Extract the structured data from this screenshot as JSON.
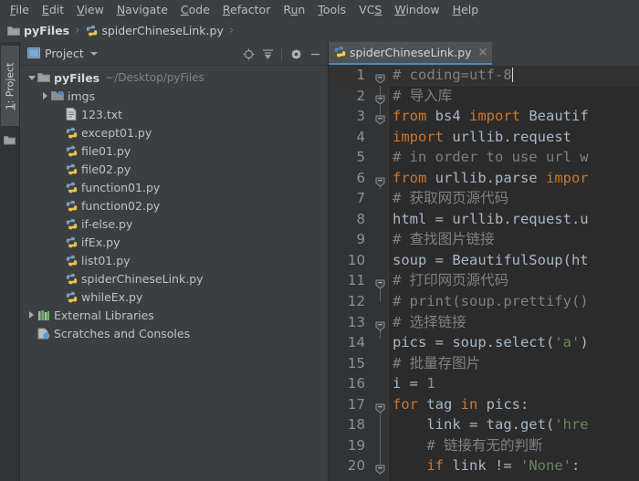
{
  "window": {
    "strip_color": "#8ab4d8"
  },
  "menubar": {
    "items": [
      {
        "label": "File",
        "mnemonic": "F"
      },
      {
        "label": "Edit",
        "mnemonic": "E"
      },
      {
        "label": "View",
        "mnemonic": "V"
      },
      {
        "label": "Navigate",
        "mnemonic": "N"
      },
      {
        "label": "Code",
        "mnemonic": "C"
      },
      {
        "label": "Refactor",
        "mnemonic": "R"
      },
      {
        "label": "Run",
        "mnemonic": "u"
      },
      {
        "label": "Tools",
        "mnemonic": "T"
      },
      {
        "label": "VCS",
        "mnemonic": "S"
      },
      {
        "label": "Window",
        "mnemonic": "W"
      },
      {
        "label": "Help",
        "mnemonic": "H"
      }
    ]
  },
  "breadcrumb": {
    "items": [
      {
        "label": "pyFiles",
        "icon": "folder-icon",
        "bold": true
      },
      {
        "label": "spiderChineseLink.py",
        "icon": "python-file-icon",
        "bold": false
      }
    ],
    "separator": "›"
  },
  "toolstrip": {
    "vertical_tab": {
      "label": "1: Project",
      "mnemonic": "1"
    },
    "bottom_icon": "folder-icon"
  },
  "project_panel": {
    "title": "Project",
    "actions": [
      {
        "name": "locate-icon",
        "tooltip": "Select Opened File"
      },
      {
        "name": "collapse-all-icon",
        "tooltip": "Collapse All"
      },
      {
        "name": "gear-icon",
        "tooltip": "Settings"
      },
      {
        "name": "minimize-icon",
        "tooltip": "Hide"
      }
    ],
    "tree": [
      {
        "label": "pyFiles",
        "sub": "~/Desktop/pyFiles",
        "indent": 0,
        "twisty": "down",
        "icon": "folder-icon",
        "bold": true
      },
      {
        "label": "imgs",
        "sub": "",
        "indent": 1,
        "twisty": "right",
        "icon": "folder-blue-icon",
        "bold": false
      },
      {
        "label": "123.txt",
        "sub": "",
        "indent": 2,
        "twisty": "none",
        "icon": "text-file-icon",
        "bold": false
      },
      {
        "label": "except01.py",
        "sub": "",
        "indent": 2,
        "twisty": "none",
        "icon": "python-file-icon",
        "bold": false
      },
      {
        "label": "file01.py",
        "sub": "",
        "indent": 2,
        "twisty": "none",
        "icon": "python-file-icon",
        "bold": false
      },
      {
        "label": "file02.py",
        "sub": "",
        "indent": 2,
        "twisty": "none",
        "icon": "python-file-icon",
        "bold": false
      },
      {
        "label": "function01.py",
        "sub": "",
        "indent": 2,
        "twisty": "none",
        "icon": "python-file-icon",
        "bold": false
      },
      {
        "label": "function02.py",
        "sub": "",
        "indent": 2,
        "twisty": "none",
        "icon": "python-file-icon",
        "bold": false
      },
      {
        "label": "if-else.py",
        "sub": "",
        "indent": 2,
        "twisty": "none",
        "icon": "python-file-icon",
        "bold": false
      },
      {
        "label": "ifEx.py",
        "sub": "",
        "indent": 2,
        "twisty": "none",
        "icon": "python-file-icon",
        "bold": false
      },
      {
        "label": "list01.py",
        "sub": "",
        "indent": 2,
        "twisty": "none",
        "icon": "python-file-icon",
        "bold": false
      },
      {
        "label": "spiderChineseLink.py",
        "sub": "",
        "indent": 2,
        "twisty": "none",
        "icon": "python-file-icon",
        "bold": false
      },
      {
        "label": "whileEx.py",
        "sub": "",
        "indent": 2,
        "twisty": "none",
        "icon": "python-file-icon",
        "bold": false
      },
      {
        "label": "External Libraries",
        "sub": "",
        "indent": 0,
        "twisty": "right",
        "icon": "library-icon",
        "bold": false
      },
      {
        "label": "Scratches and Consoles",
        "sub": "",
        "indent": 0,
        "twisty": "none",
        "icon": "scratches-icon",
        "bold": false
      }
    ]
  },
  "editor": {
    "tab": {
      "label": "spiderChineseLink.py",
      "icon": "python-file-icon",
      "close": "×",
      "active_underline": "#4a88c7"
    },
    "current_line": 1,
    "lines": [
      {
        "n": 1,
        "fold": "collapsed-start",
        "tokens": [
          {
            "t": "# coding=utf-8",
            "c": "com"
          }
        ],
        "caret_after": true
      },
      {
        "n": 2,
        "fold": "collapsed-start",
        "tokens": [
          {
            "t": "# 导入库",
            "c": "com"
          }
        ]
      },
      {
        "n": 3,
        "fold": "collapsed-start",
        "tokens": [
          {
            "t": "from",
            "c": "kw"
          },
          {
            "t": " bs4 ",
            "c": "plain"
          },
          {
            "t": "import",
            "c": "kw"
          },
          {
            "t": " Beautif",
            "c": "plain"
          }
        ]
      },
      {
        "n": 4,
        "fold": "none",
        "tokens": [
          {
            "t": "import",
            "c": "kw"
          },
          {
            "t": " urllib.request",
            "c": "plain"
          }
        ]
      },
      {
        "n": 5,
        "fold": "none",
        "tokens": [
          {
            "t": "# in order to use url w",
            "c": "com"
          }
        ]
      },
      {
        "n": 6,
        "fold": "collapsed-start",
        "tokens": [
          {
            "t": "from",
            "c": "kw"
          },
          {
            "t": " urllib.parse ",
            "c": "plain"
          },
          {
            "t": "impor",
            "c": "kw"
          }
        ]
      },
      {
        "n": 7,
        "fold": "none",
        "tokens": [
          {
            "t": "# 获取网页源代码",
            "c": "com"
          }
        ]
      },
      {
        "n": 8,
        "fold": "none",
        "tokens": [
          {
            "t": "html = urllib.request.u",
            "c": "plain"
          }
        ]
      },
      {
        "n": 9,
        "fold": "none",
        "tokens": [
          {
            "t": "# 查找图片链接",
            "c": "com"
          }
        ]
      },
      {
        "n": 10,
        "fold": "none",
        "tokens": [
          {
            "t": "soup = BeautifulSoup(ht",
            "c": "plain"
          }
        ]
      },
      {
        "n": 11,
        "fold": "collapsed-start",
        "tokens": [
          {
            "t": "# 打印网页源代码",
            "c": "com"
          }
        ]
      },
      {
        "n": 12,
        "fold": "none",
        "tokens": [
          {
            "t": "# print(soup.prettify()",
            "c": "com"
          }
        ]
      },
      {
        "n": 13,
        "fold": "collapsed-start",
        "tokens": [
          {
            "t": "# 选择链接",
            "c": "com"
          }
        ]
      },
      {
        "n": 14,
        "fold": "none",
        "tokens": [
          {
            "t": "pics = soup.select(",
            "c": "plain"
          },
          {
            "t": "'a'",
            "c": "str"
          },
          {
            "t": ")",
            "c": "plain"
          }
        ]
      },
      {
        "n": 15,
        "fold": "none",
        "tokens": [
          {
            "t": "# 批量存图片",
            "c": "com"
          }
        ]
      },
      {
        "n": 16,
        "fold": "none",
        "tokens": [
          {
            "t": "i = ",
            "c": "plain"
          },
          {
            "t": "1",
            "c": "num"
          }
        ]
      },
      {
        "n": 17,
        "fold": "collapsed-start",
        "tokens": [
          {
            "t": "for",
            "c": "kw"
          },
          {
            "t": " tag ",
            "c": "plain"
          },
          {
            "t": "in",
            "c": "kw"
          },
          {
            "t": " pics:",
            "c": "plain"
          }
        ]
      },
      {
        "n": 18,
        "fold": "none",
        "tokens": [
          {
            "t": "    link = tag.get(",
            "c": "plain"
          },
          {
            "t": "'hre",
            "c": "str"
          }
        ]
      },
      {
        "n": 19,
        "fold": "none",
        "tokens": [
          {
            "t": "    # 链接有无的判断",
            "c": "com"
          }
        ]
      },
      {
        "n": 20,
        "fold": "collapsed-start",
        "tokens": [
          {
            "t": "    ",
            "c": "plain"
          },
          {
            "t": "if",
            "c": "kw"
          },
          {
            "t": " link != ",
            "c": "plain"
          },
          {
            "t": "'None'",
            "c": "str"
          },
          {
            "t": ":",
            "c": "plain"
          }
        ]
      }
    ]
  },
  "colors": {
    "chrome": "#3c3f41",
    "editor_bg": "#2b2b2b",
    "gutter_bg": "#313335",
    "keyword": "#cc7832",
    "plain": "#a9b7c6",
    "comment": "#808080",
    "string": "#6a8759",
    "number": "#6897bb",
    "accent": "#4a88c7"
  }
}
